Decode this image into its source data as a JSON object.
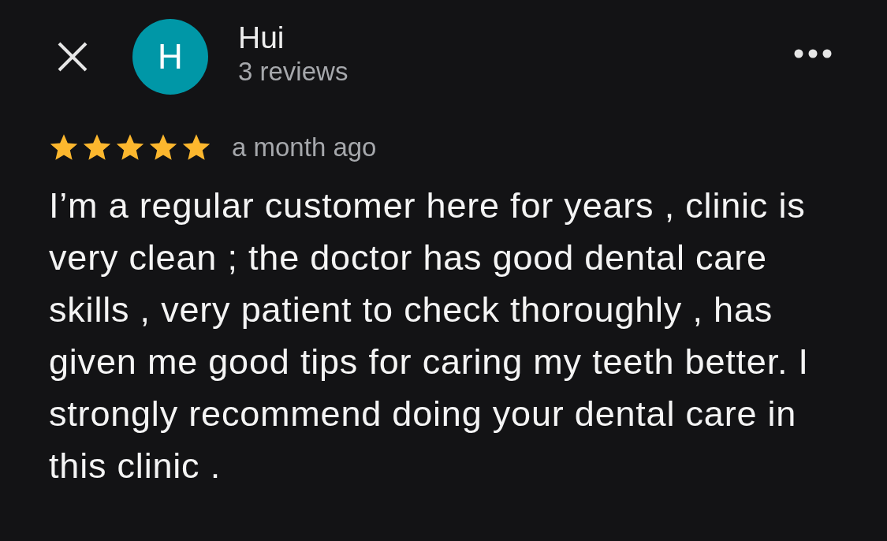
{
  "header": {
    "avatar_letter": "H",
    "name": "Hui",
    "subtitle": "3 reviews"
  },
  "review": {
    "stars": 5,
    "time": "a month ago",
    "text": "I’m a regular customer here for years , clinic is very clean ; the doctor has good dental care skills , very patient to check thoroughly , has given me good tips for caring my teeth better. I strongly recommend doing your dental care in this clinic ."
  }
}
